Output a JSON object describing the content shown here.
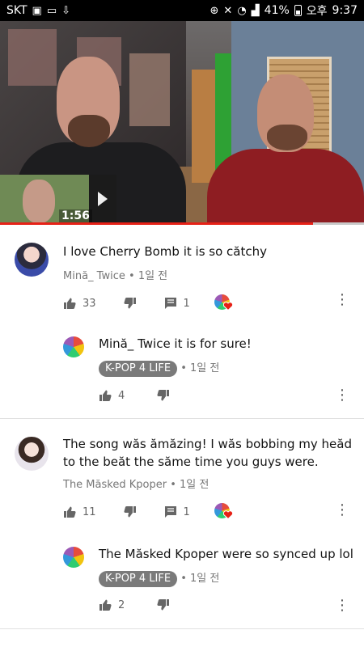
{
  "status_bar": {
    "carrier": "SKT",
    "battery": "41%",
    "time_prefix": "오후",
    "time": "9:37"
  },
  "video": {
    "elapsed_time": "1:56",
    "progress_fraction": 0.86
  },
  "comments": [
    {
      "text": "I love Cherry Bomb it is so cătchy",
      "author": "Mină_ Twice",
      "age": "1일 전",
      "likes": "33",
      "replies": "1"
    },
    {
      "text": "Mină_ Twice it is for sure!",
      "author_tag": "K-POP 4 LIFE",
      "age": "1일 전",
      "likes": "4"
    },
    {
      "text_line1": "The song wăs ămăzing! I wăs bobbing my heăd",
      "text_line2": "to the beăt the săme time you guys were.",
      "author": "The Măsked Kpoper",
      "age": "1일 전",
      "likes": "11",
      "replies": "1"
    },
    {
      "text": "The Măsked Kpoper were so synced up lol",
      "author_tag": "K-POP 4 LIFE",
      "age": "1일 전",
      "likes": "2"
    }
  ],
  "meta_separator": "•",
  "icons": [
    "like-icon",
    "dislike-icon",
    "reply-icon",
    "more-icon",
    "creator-heart-icon"
  ],
  "colors": {
    "progress": "#e62117",
    "tag_bg": "#7a7a7a",
    "heart": "#e62117"
  }
}
